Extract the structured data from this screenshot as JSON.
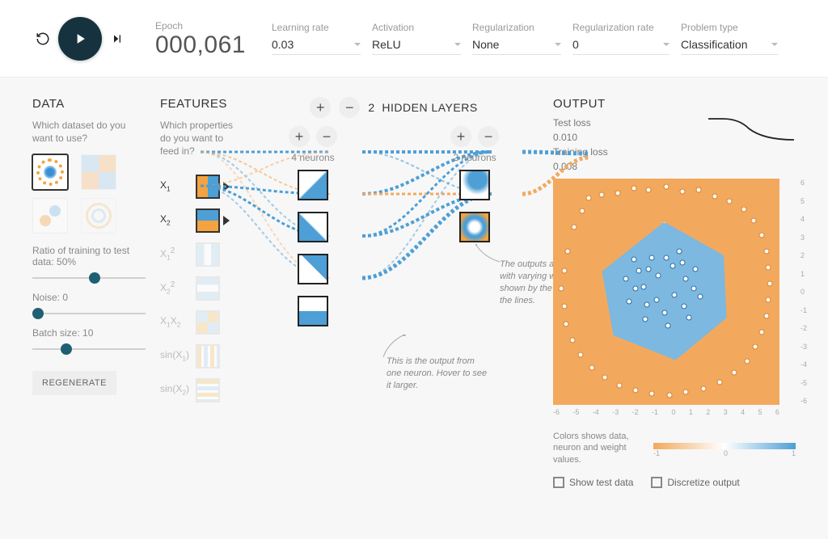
{
  "top": {
    "epoch_label": "Epoch",
    "epoch_value": "000,061",
    "controls": {
      "learning_rate": {
        "label": "Learning rate",
        "value": "0.03"
      },
      "activation": {
        "label": "Activation",
        "value": "ReLU"
      },
      "regularization": {
        "label": "Regularization",
        "value": "None"
      },
      "reg_rate": {
        "label": "Regularization rate",
        "value": "0"
      },
      "problem_type": {
        "label": "Problem type",
        "value": "Classification"
      }
    }
  },
  "data_panel": {
    "title": "DATA",
    "subtitle": "Which dataset do you want to use?",
    "datasets": [
      "circle",
      "xor",
      "gauss",
      "spiral"
    ],
    "selected_dataset": "circle",
    "ratio_label": "Ratio of training to test data:  50%",
    "ratio_value": 50,
    "noise_label": "Noise:  0",
    "noise_value": 0,
    "batch_label": "Batch size:  10",
    "batch_value": 10,
    "regenerate": "REGENERATE"
  },
  "features_panel": {
    "title": "FEATURES",
    "subtitle": "Which properties do you want to feed in?",
    "items": [
      {
        "id": "x1",
        "label": "X₁",
        "enabled": true
      },
      {
        "id": "x2",
        "label": "X₂",
        "enabled": true
      },
      {
        "id": "x1sq",
        "label": "X₁²",
        "enabled": false
      },
      {
        "id": "x2sq",
        "label": "X₂²",
        "enabled": false
      },
      {
        "id": "x1x2",
        "label": "X₁X₂",
        "enabled": false
      },
      {
        "id": "sinx1",
        "label": "sin(X₁)",
        "enabled": false
      },
      {
        "id": "sinx2",
        "label": "sin(X₂)",
        "enabled": false
      }
    ]
  },
  "network": {
    "heading_count": "2",
    "heading_text": "HIDDEN LAYERS",
    "layers": [
      {
        "neurons": 4,
        "caption": "4 neurons"
      },
      {
        "neurons": 2,
        "caption": "2 neurons"
      }
    ],
    "callout_neuron": "This is the output from one neuron. Hover to see it larger.",
    "callout_weights": "The outputs are mixed with varying weights, shown by the thickness of the lines."
  },
  "output": {
    "title": "OUTPUT",
    "test_loss_label": "Test loss",
    "test_loss": "0.010",
    "train_loss_label": "Training loss",
    "train_loss": "0.008",
    "x_ticks": [
      "-6",
      "-5",
      "-4",
      "-3",
      "-2",
      "-1",
      "0",
      "1",
      "2",
      "3",
      "4",
      "5",
      "6"
    ],
    "y_ticks": [
      "6",
      "5",
      "4",
      "3",
      "2",
      "1",
      "0",
      "-1",
      "-2",
      "-3",
      "-4",
      "-5",
      "-6"
    ],
    "legend_text": "Colors shows data, neuron and weight values.",
    "legend_ticks": [
      "-1",
      "0",
      "1"
    ],
    "show_test_label": "Show test data",
    "discretize_label": "Discretize output"
  },
  "colors": {
    "orange": "#f2a95e",
    "blue": "#4d9fd6",
    "darkblue": "#17323f"
  }
}
